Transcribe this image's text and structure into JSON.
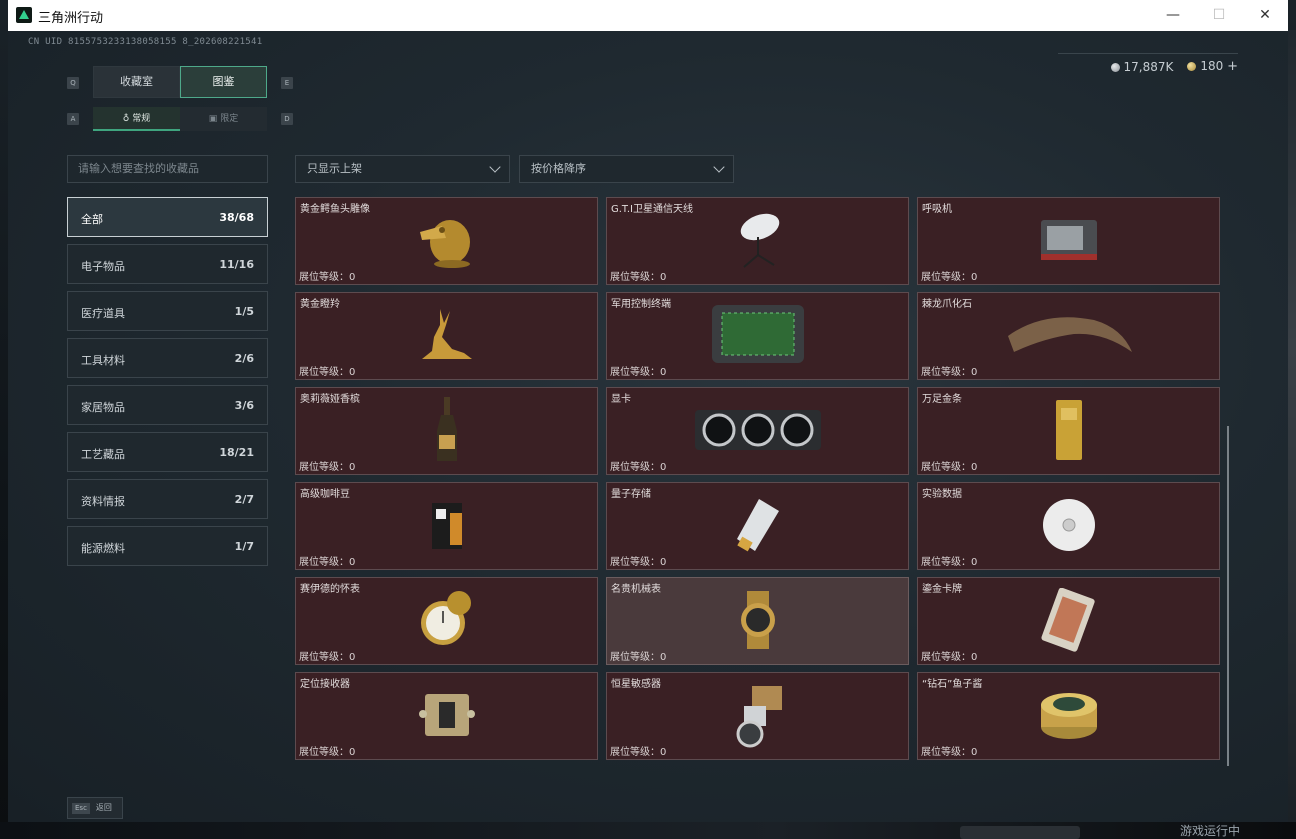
{
  "window": {
    "title": "三角洲行动",
    "minimize": "—",
    "maximize": "☐",
    "close": "✕"
  },
  "header": {
    "uid": "CN UID 8155753233138058155 8_202608221541",
    "silver": "17,887K",
    "gold": "180",
    "plus": "+"
  },
  "keys": {
    "tab_left": "Q",
    "tab_right": "E",
    "sub_left": "A",
    "sub_right": "D"
  },
  "tabs": [
    {
      "label": "收藏室",
      "active": false
    },
    {
      "label": "图鉴",
      "active": true
    }
  ],
  "subtabs": [
    {
      "label": "常规",
      "icon": "♁",
      "active": true
    },
    {
      "label": "限定",
      "icon": "▣",
      "active": false
    }
  ],
  "search": {
    "placeholder": "请输入想要查找的收藏品"
  },
  "filters": {
    "availability": "只显示上架",
    "sort": "按价格降序"
  },
  "categories": [
    {
      "name": "全部",
      "count": "38/68",
      "active": true
    },
    {
      "name": "电子物品",
      "count": "11/16"
    },
    {
      "name": "医疗道具",
      "count": "1/5"
    },
    {
      "name": "工具材料",
      "count": "2/6"
    },
    {
      "name": "家居物品",
      "count": "3/6"
    },
    {
      "name": "工艺藏品",
      "count": "18/21"
    },
    {
      "name": "资料情报",
      "count": "2/7"
    },
    {
      "name": "能源燃料",
      "count": "1/7"
    }
  ],
  "items": [
    {
      "name": "黄金鳄鱼头雕像",
      "level": "展位等级：0",
      "icon": "gold-croc-icon"
    },
    {
      "name": "G.T.I卫星通信天线",
      "level": "展位等级：0",
      "icon": "satellite-dish-icon"
    },
    {
      "name": "呼吸机",
      "level": "展位等级：0",
      "icon": "ventilator-icon"
    },
    {
      "name": "黄金瞪羚",
      "level": "展位等级：0",
      "icon": "gold-gazelle-icon"
    },
    {
      "name": "军用控制终端",
      "level": "展位等级：0",
      "icon": "control-terminal-icon"
    },
    {
      "name": "棘龙爪化石",
      "level": "展位等级：0",
      "icon": "claw-fossil-icon"
    },
    {
      "name": "奥莉薇娅香槟",
      "level": "展位等级：0",
      "icon": "champagne-icon"
    },
    {
      "name": "显卡",
      "level": "展位等级：0",
      "icon": "gpu-icon"
    },
    {
      "name": "万足金条",
      "level": "展位等级：0",
      "icon": "gold-bar-icon"
    },
    {
      "name": "高级咖啡豆",
      "level": "展位等级：0",
      "icon": "coffee-bag-icon"
    },
    {
      "name": "量子存储",
      "level": "展位等级：0",
      "icon": "quantum-drive-icon"
    },
    {
      "name": "实验数据",
      "level": "展位等级：0",
      "icon": "data-disc-icon"
    },
    {
      "name": "赛伊德的怀表",
      "level": "展位等级：0",
      "icon": "pocket-watch-icon"
    },
    {
      "name": "名贵机械表",
      "level": "展位等级：0",
      "icon": "wristwatch-icon",
      "highlight": true
    },
    {
      "name": "鎏金卡牌",
      "level": "展位等级：0",
      "icon": "gilded-card-icon"
    },
    {
      "name": "定位接收器",
      "level": "展位等级：0",
      "icon": "locator-receiver-icon"
    },
    {
      "name": "恒星敏感器",
      "level": "展位等级：0",
      "icon": "star-sensor-icon"
    },
    {
      "name": "“钻石”鱼子酱",
      "level": "展位等级：0",
      "icon": "caviar-tin-icon"
    }
  ],
  "footer": {
    "esc_key": "Esc",
    "back": "返回"
  },
  "taskbar": {
    "text": "游戏运行中"
  }
}
